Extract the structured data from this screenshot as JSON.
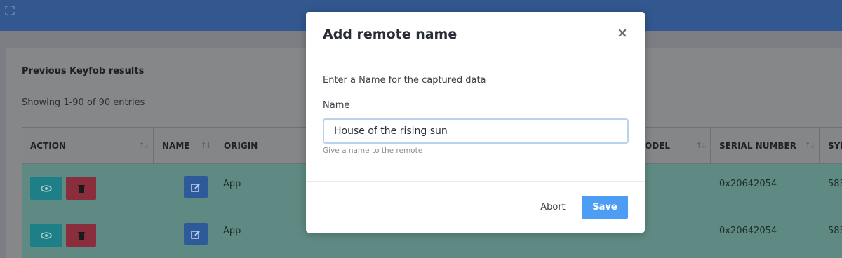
{
  "header": {
    "expand_icon": "expand-icon"
  },
  "card": {
    "title": "Previous Keyfob results",
    "showing": "Showing 1-90 of 90 entries"
  },
  "table": {
    "columns": [
      "ACTION",
      "NAME",
      "ORIGIN",
      "ODEL",
      "SERIAL NUMBER",
      "SYN"
    ],
    "sort_glyph": "↑↓",
    "rows": [
      {
        "origin": "App",
        "serial": "0x20642054",
        "syn": "583"
      },
      {
        "origin": "App",
        "serial": "0x20642054",
        "syn": "583"
      }
    ],
    "row_color": "#5f8a83"
  },
  "modal": {
    "title": "Add remote name",
    "close_icon": "close-icon",
    "prompt": "Enter a Name for the captured data",
    "field_label": "Name",
    "input_value": "House of the rising sun",
    "help": "Give a name to the remote",
    "abort_label": "Abort",
    "save_label": "Save",
    "accent": "#4d9df5"
  }
}
